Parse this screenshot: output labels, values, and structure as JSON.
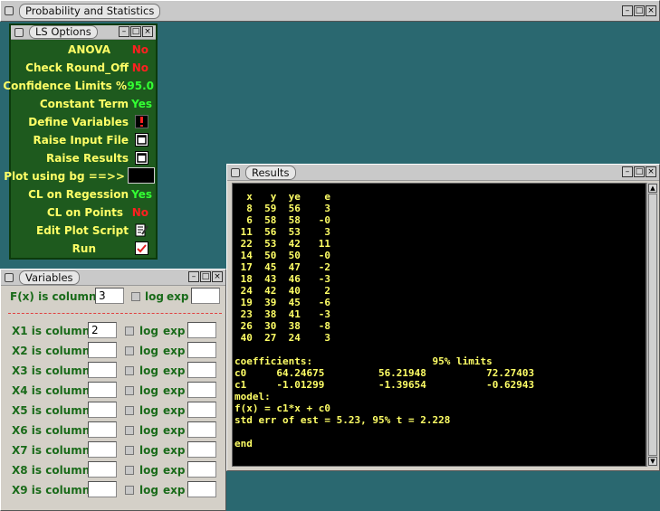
{
  "main_window": {
    "title": "Probability and Statistics"
  },
  "ls_options": {
    "title": "LS Options",
    "rows": [
      {
        "label": "ANOVA",
        "value": "No"
      },
      {
        "label": "Check Round_Off",
        "value": "No"
      },
      {
        "label": "Confidence Limits %",
        "value": "95.0"
      },
      {
        "label": "Constant Term",
        "value": "Yes"
      },
      {
        "label": "Define Variables",
        "icon": "exclamation-icon"
      },
      {
        "label": "Raise Input File",
        "icon": "window-icon"
      },
      {
        "label": "Raise Results",
        "icon": "window-icon"
      },
      {
        "label": "Plot using bg ==>>",
        "icon": "color-swatch"
      },
      {
        "label": "CL on Regession",
        "value": "Yes"
      },
      {
        "label": "CL on Points",
        "value": "No"
      },
      {
        "label": "Edit Plot Script",
        "icon": "edit-icon"
      },
      {
        "label": "Run",
        "icon": "checkmark-icon"
      }
    ]
  },
  "variables": {
    "title": "Variables",
    "fx": {
      "label": "F(x) is column",
      "value": "3",
      "log": "log",
      "exp": "exp"
    },
    "rows": [
      {
        "label": "X1 is column",
        "value": "2"
      },
      {
        "label": "X2 is column",
        "value": ""
      },
      {
        "label": "X3 is column",
        "value": ""
      },
      {
        "label": "X4 is column",
        "value": ""
      },
      {
        "label": "X5 is column",
        "value": ""
      },
      {
        "label": "X6 is column",
        "value": ""
      },
      {
        "label": "X7 is column",
        "value": ""
      },
      {
        "label": "X8 is column",
        "value": ""
      },
      {
        "label": "X9 is column",
        "value": ""
      }
    ],
    "log_label": "log",
    "exp_label": "exp"
  },
  "results": {
    "title": "Results",
    "text": "  x   y  ye    e\n  8  59  56    3\n  6  58  58   -0\n 11  56  53    3\n 22  53  42   11\n 14  50  50   -0\n 17  45  47   -2\n 18  43  46   -3\n 24  42  40    2\n 19  39  45   -6\n 23  38  41   -3\n 26  30  38   -8\n 40  27  24    3\n\ncoefficients:                    95% limits\nc0     64.24675         56.21948          72.27403\nc1     -1.01299         -1.39654          -0.62943\nmodel:\nf(x) = c1*x + c0\nstd err of est = 5.23, 95% t = 2.228\n\nend"
  },
  "colors": {
    "desktop": "#2a6870",
    "ls_bg": "#1e5a1e",
    "label_yellow": "#ffff66",
    "value_red": "#ff2020",
    "value_green": "#33ff33",
    "results_text": "#ffff66"
  }
}
